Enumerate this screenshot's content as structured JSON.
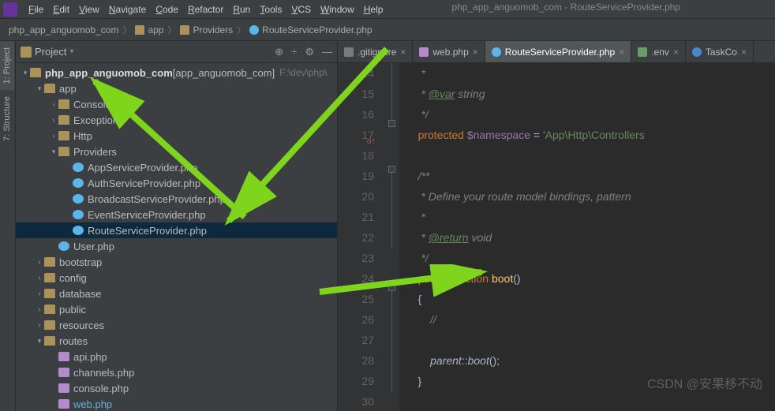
{
  "menu": [
    "File",
    "Edit",
    "View",
    "Navigate",
    "Code",
    "Refactor",
    "Run",
    "Tools",
    "VCS",
    "Window",
    "Help"
  ],
  "windowTitle": "php_app_anguomob_com - RouteServiceProvider.php",
  "breadcrumb": {
    "items": [
      "php_app_anguomob_com",
      "app",
      "Providers",
      "RouteServiceProvider.php"
    ]
  },
  "sideTools": {
    "project": "1: Project",
    "structure": "7: Structure"
  },
  "panel": {
    "title": "Project",
    "rootName": "php_app_anguomob_com",
    "rootModule": "[app_anguomob_com]",
    "rootPath": "F:\\dev\\php\\",
    "tree": [
      {
        "d": 0,
        "exp": true,
        "ic": "folder",
        "name": "php_app_anguomob_com",
        "module": true
      },
      {
        "d": 1,
        "exp": true,
        "ic": "folder",
        "name": "app"
      },
      {
        "d": 2,
        "exp": false,
        "ic": "folder",
        "name": "Console"
      },
      {
        "d": 2,
        "exp": false,
        "ic": "folder",
        "name": "Exceptions"
      },
      {
        "d": 2,
        "exp": false,
        "ic": "folder",
        "name": "Http"
      },
      {
        "d": 2,
        "exp": true,
        "ic": "folder",
        "name": "Providers"
      },
      {
        "d": 3,
        "ic": "php",
        "name": "AppServiceProvider.php"
      },
      {
        "d": 3,
        "ic": "php",
        "name": "AuthServiceProvider.php"
      },
      {
        "d": 3,
        "ic": "php",
        "name": "BroadcastServiceProvider.php"
      },
      {
        "d": 3,
        "ic": "php",
        "name": "EventServiceProvider.php"
      },
      {
        "d": 3,
        "ic": "php",
        "name": "RouteServiceProvider.php",
        "selected": true
      },
      {
        "d": 2,
        "ic": "php",
        "name": "User.php"
      },
      {
        "d": 1,
        "exp": false,
        "ic": "folder",
        "name": "bootstrap"
      },
      {
        "d": 1,
        "exp": false,
        "ic": "folder",
        "name": "config"
      },
      {
        "d": 1,
        "exp": false,
        "ic": "folder",
        "name": "database"
      },
      {
        "d": 1,
        "exp": false,
        "ic": "folder",
        "name": "public"
      },
      {
        "d": 1,
        "exp": false,
        "ic": "folder",
        "name": "resources"
      },
      {
        "d": 1,
        "exp": true,
        "ic": "folder",
        "name": "routes"
      },
      {
        "d": 2,
        "ic": "phpf",
        "name": "api.php"
      },
      {
        "d": 2,
        "ic": "phpf",
        "name": "channels.php"
      },
      {
        "d": 2,
        "ic": "phpf",
        "name": "console.php"
      },
      {
        "d": 2,
        "ic": "phpf",
        "name": "web.php",
        "hl": true
      }
    ]
  },
  "tabs": [
    {
      "icon": "git",
      "label": ".gitignore"
    },
    {
      "icon": "phpf",
      "label": "web.php"
    },
    {
      "icon": "php",
      "label": "RouteServiceProvider.php",
      "active": true
    },
    {
      "icon": "env",
      "label": ".env"
    },
    {
      "icon": "task",
      "label": "TaskCo"
    }
  ],
  "code": {
    "start": 14,
    "lines": [
      {
        "n": 14,
        "html": "     <span class='c-comment'>*</span>"
      },
      {
        "n": 15,
        "html": "     <span class='c-comment'>* <span class='c-doctag'>@var</span> string</span>"
      },
      {
        "n": 16,
        "html": "     <span class='c-comment'>*/</span>"
      },
      {
        "n": 17,
        "mark": "o",
        "html": "    <span class='c-keyword'>protected</span> <span class='c-var'>$namespace</span> = <span class='c-string'>'App\\Http\\Controllers</span>"
      },
      {
        "n": 18,
        "html": ""
      },
      {
        "n": 19,
        "html": "    <span class='c-comment'>/**</span>"
      },
      {
        "n": 20,
        "html": "     <span class='c-comment'>* Define your route model bindings, pattern</span>"
      },
      {
        "n": 21,
        "html": "     <span class='c-comment'>*</span>"
      },
      {
        "n": 22,
        "html": "     <span class='c-comment'>* <span class='c-doctag'>@return</span> void</span>"
      },
      {
        "n": 23,
        "html": "     <span class='c-comment'>*/</span>"
      },
      {
        "n": 24,
        "mark": "o",
        "html": "    <span class='c-keyword'>public</span> <span class='c-keyword'>function</span> <span class='c-fn'>boot</span>()"
      },
      {
        "n": 25,
        "html": "    {"
      },
      {
        "n": 26,
        "html": "        <span class='c-comment'>//</span>"
      },
      {
        "n": 27,
        "html": ""
      },
      {
        "n": 28,
        "html": "        <span class='c-static'>parent</span>::<span class='c-fn c-static'>boot</span>();"
      },
      {
        "n": 29,
        "html": "    }"
      },
      {
        "n": 30,
        "html": ""
      }
    ]
  },
  "watermark": "CSDN @安果移不动"
}
